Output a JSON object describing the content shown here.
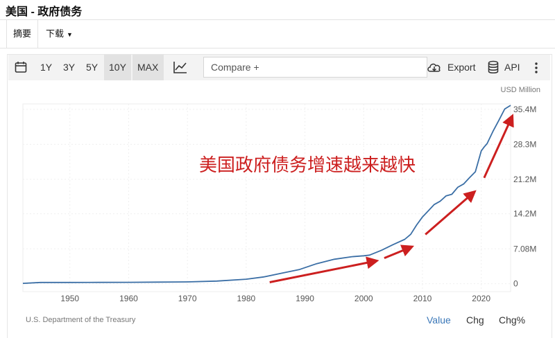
{
  "header": {
    "title": "美国 - 政府债务"
  },
  "tabs": [
    {
      "label": "摘要"
    },
    {
      "label": "下载"
    }
  ],
  "toolbar": {
    "ranges": [
      "1Y",
      "3Y",
      "5Y",
      "10Y",
      "MAX"
    ],
    "active_range": "10Y",
    "compare_placeholder": "Compare +",
    "export_label": "Export",
    "api_label": "API",
    "icons": [
      "calendar-icon",
      "line-chart-icon",
      "cloud-download-icon",
      "database-icon",
      "more-vertical-icon"
    ]
  },
  "footer": {
    "source": "U.S. Department of the Treasury",
    "tabs": [
      "Value",
      "Chg",
      "Chg%"
    ],
    "active_tab": "Value"
  },
  "colors": {
    "series": "#3a6ea5",
    "accent": "#3a77b8",
    "annotation": "#cc1f1f"
  },
  "chart_data": {
    "type": "line",
    "unit_label": "USD Million",
    "annotation": "美国政府债务增速越来越快",
    "x_ticks": [
      "1950",
      "1960",
      "1970",
      "1980",
      "1990",
      "2000",
      "2010",
      "2020"
    ],
    "y_ticks": [
      "0",
      "7.08M",
      "14.2M",
      "21.2M",
      "28.3M",
      "35.4M"
    ],
    "xlim": [
      1942,
      2025
    ],
    "ylim": [
      -1.6,
      36.5
    ],
    "grid": true,
    "series": [
      {
        "x": [
          1942,
          1945,
          1950,
          1955,
          1960,
          1965,
          1970,
          1975,
          1980,
          1983,
          1986,
          1989,
          1992,
          1995,
          1998,
          2000,
          2001,
          2003,
          2005,
          2007,
          2008,
          2009,
          2010,
          2011,
          2012,
          2013,
          2014,
          2015,
          2016,
          2017,
          2018,
          2019,
          2020,
          2020.5,
          2021,
          2022,
          2023,
          2024,
          2025
        ],
        "y": [
          0.08,
          0.26,
          0.26,
          0.27,
          0.29,
          0.32,
          0.37,
          0.53,
          0.91,
          1.38,
          2.13,
          2.86,
          4.06,
          4.97,
          5.48,
          5.67,
          5.81,
          6.78,
          7.93,
          9.01,
          10.02,
          11.91,
          13.56,
          14.79,
          16.07,
          16.74,
          17.82,
          18.15,
          19.57,
          20.24,
          21.52,
          22.72,
          26.95,
          27.75,
          28.43,
          30.93,
          33.17,
          35.46,
          36.2
        ]
      }
    ]
  }
}
